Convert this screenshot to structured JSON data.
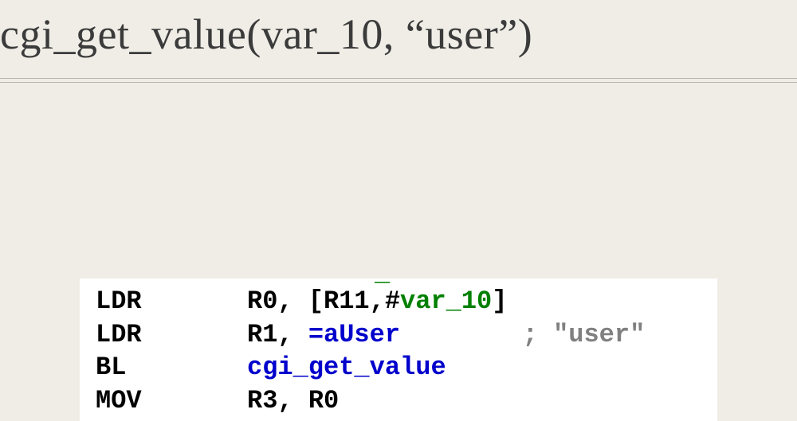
{
  "title": "cgi_get_value(var_10, “user”)",
  "artifact": "_",
  "code": {
    "row1": {
      "mnemonic": "LDR",
      "prefix": "R0, [R11,#",
      "var": "var_10",
      "suffix": "]"
    },
    "row2": {
      "mnemonic": "LDR",
      "prefix": "R1, ",
      "sym": "=aUser",
      "pad": "        ",
      "comment": "; \"user\""
    },
    "row3": {
      "mnemonic": "BL",
      "call": "cgi_get_value"
    },
    "row4": {
      "mnemonic": "MOV",
      "ops": "R3, R0"
    }
  }
}
